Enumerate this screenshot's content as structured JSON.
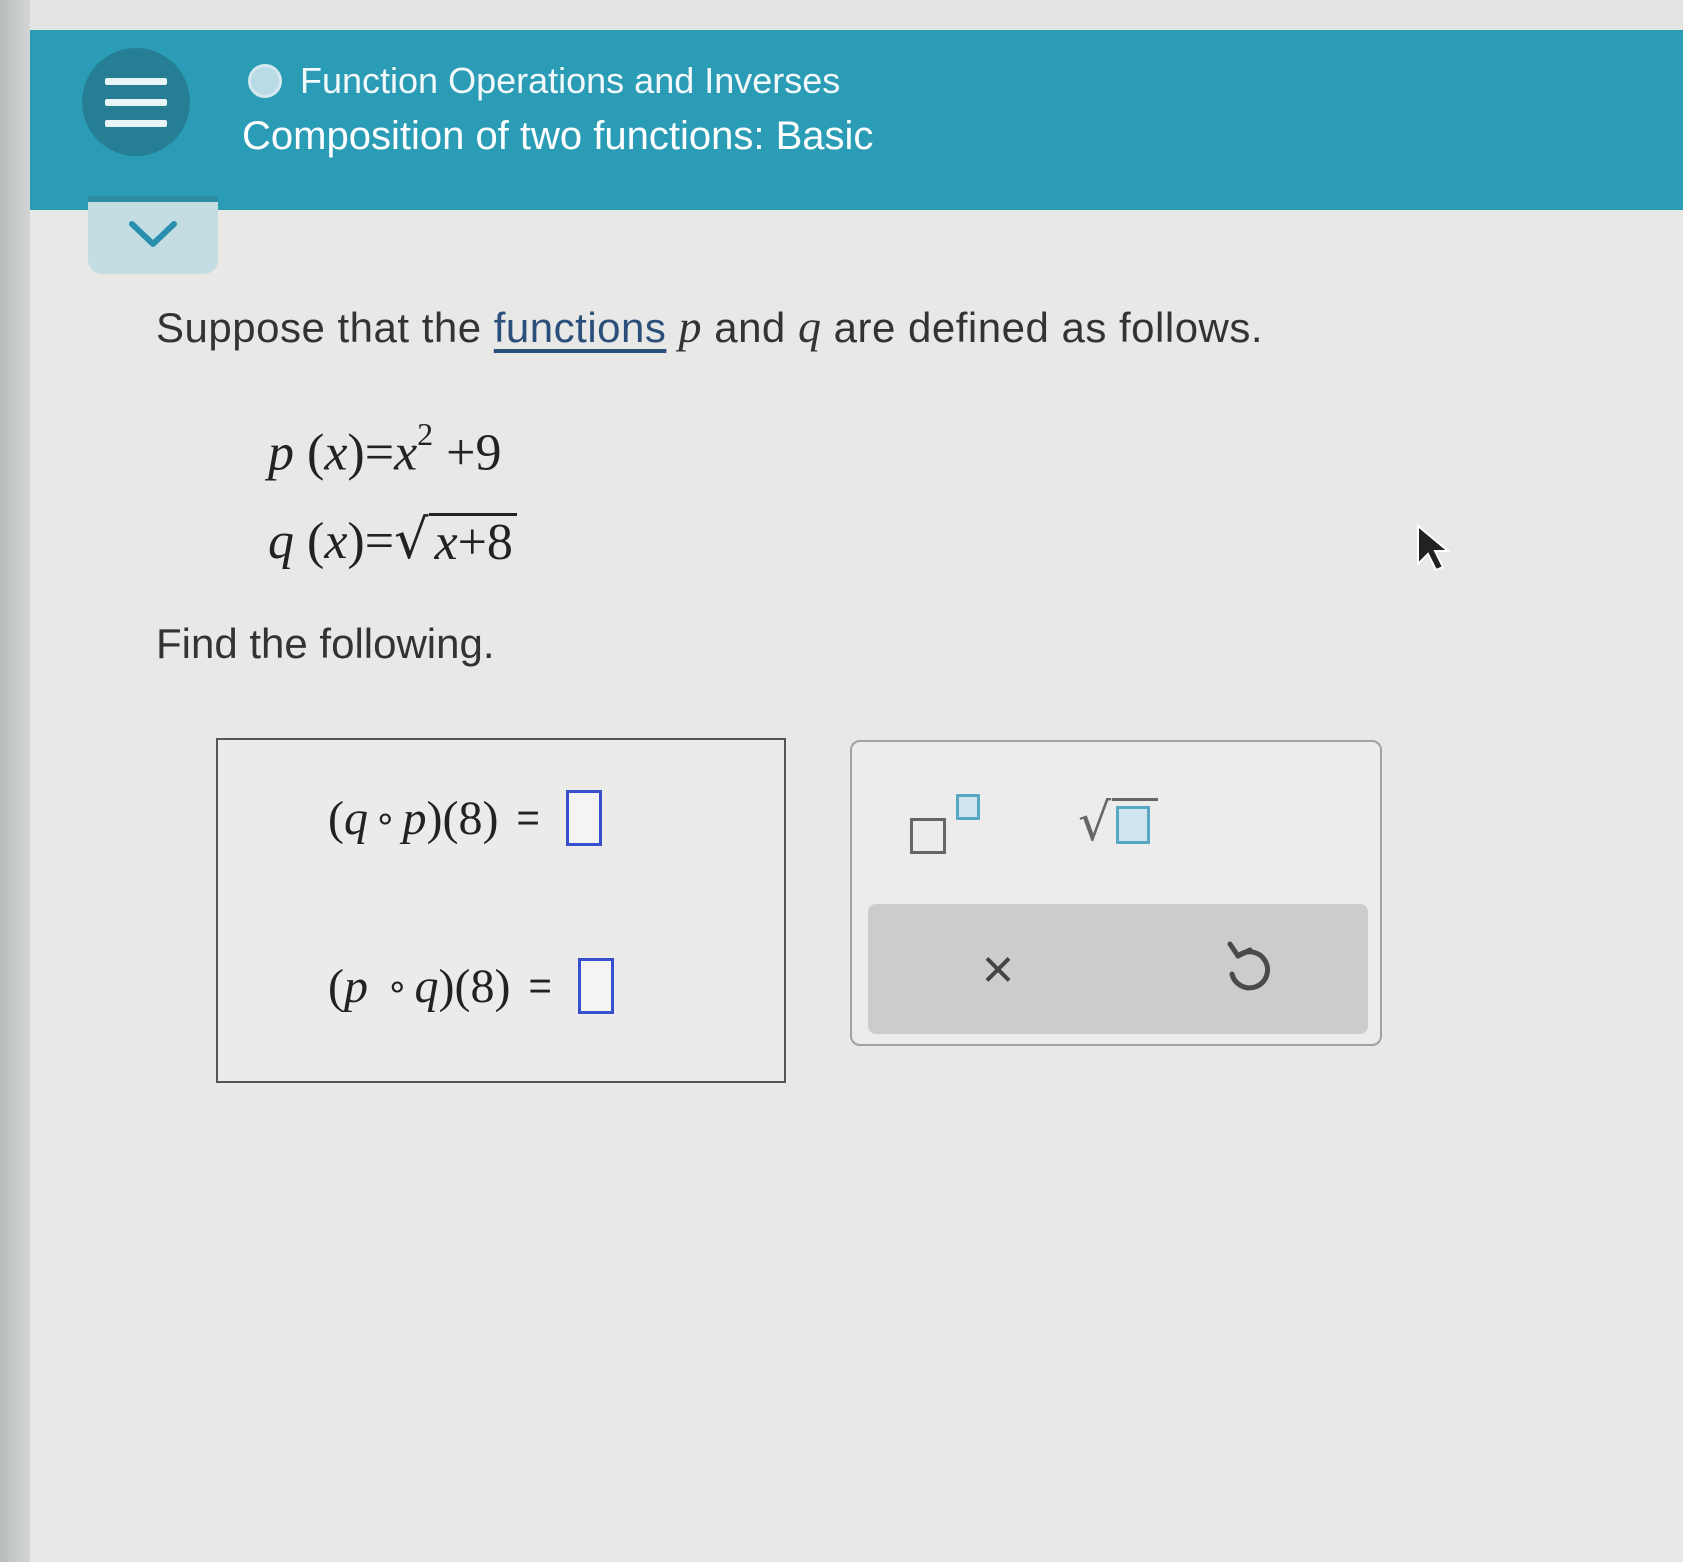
{
  "header": {
    "topic": "Function Operations and Inverses",
    "title": "Composition of two functions: Basic"
  },
  "problem": {
    "intro_before": "Suppose that the ",
    "intro_link": "functions",
    "var_p": "p",
    "intro_and": " and ",
    "var_q": "q",
    "intro_after": " are defined as follows.",
    "find_text": "Find the following."
  },
  "equations": {
    "p_lhs_name": "p",
    "p_lhs_var": "x",
    "p_rhs_var": "x",
    "p_exponent": "2",
    "p_rhs_rest": "+9",
    "q_lhs_name": "q",
    "q_lhs_var": "x",
    "q_radicand_var": "x",
    "q_radicand_rest": "+8"
  },
  "answers": [
    {
      "outer": "q",
      "inner": "p",
      "arg": "8"
    },
    {
      "outer": "p",
      "inner": "q",
      "arg": "8"
    }
  ],
  "tools": {
    "clear_symbol": "×"
  }
}
